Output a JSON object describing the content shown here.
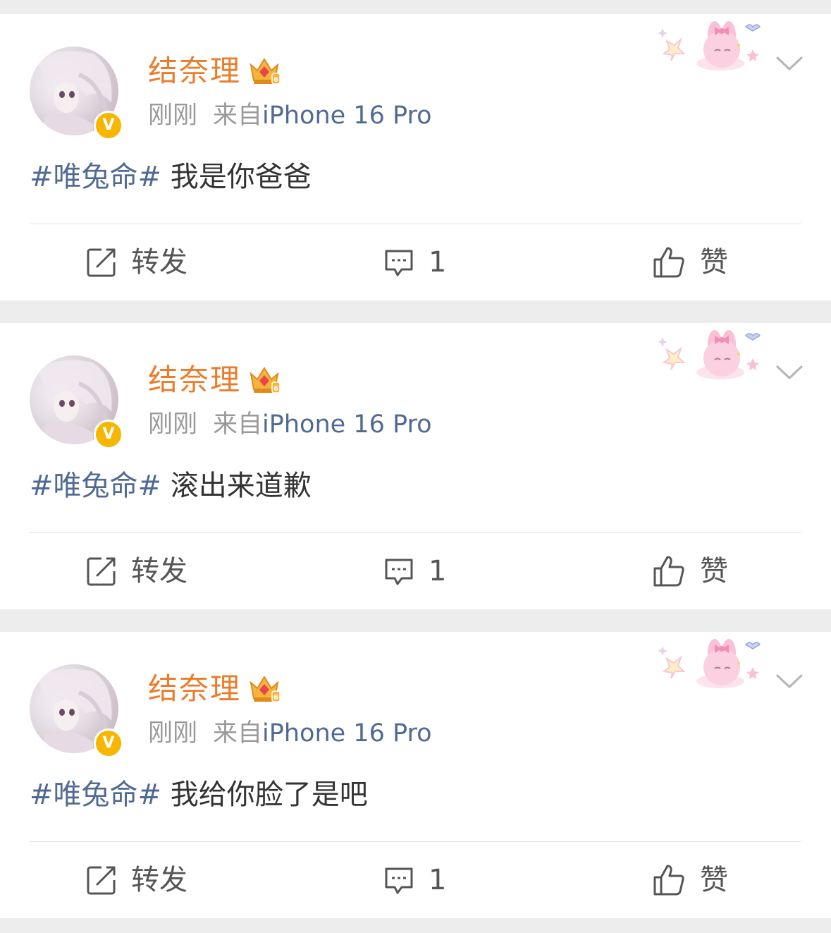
{
  "posts": [
    {
      "user_name": "结奈理",
      "timestamp": "刚刚",
      "source_prefix": "来自",
      "source_device": "iPhone 16 Pro",
      "badge": "V",
      "hashtag": "#唯兔命#",
      "content": " 我是你爸爸",
      "repost_label": "转发",
      "comment_count": "1",
      "like_label": "赞"
    },
    {
      "user_name": "结奈理",
      "timestamp": "刚刚",
      "source_prefix": "来自",
      "source_device": "iPhone 16 Pro",
      "badge": "V",
      "hashtag": "#唯兔命#",
      "content": " 滚出来道歉",
      "repost_label": "转发",
      "comment_count": "1",
      "like_label": "赞"
    },
    {
      "user_name": "结奈理",
      "timestamp": "刚刚",
      "source_prefix": "来自",
      "source_device": "iPhone 16 Pro",
      "badge": "V",
      "hashtag": "#唯兔命#",
      "content": " 我给你脸了是吧",
      "repost_label": "转发",
      "comment_count": "1",
      "like_label": "赞"
    }
  ],
  "colors": {
    "name": "#eb7c2a",
    "link": "#516a93",
    "meta": "#9a9a9a",
    "badge": "#f7b600",
    "background": "#ededed"
  },
  "icons": {
    "crown": "crown-level-6-icon",
    "decoration": "bunny-decoration",
    "more": "chevron-down-icon",
    "repost": "repost-icon",
    "comment": "comment-icon",
    "like": "thumbs-up-icon"
  }
}
